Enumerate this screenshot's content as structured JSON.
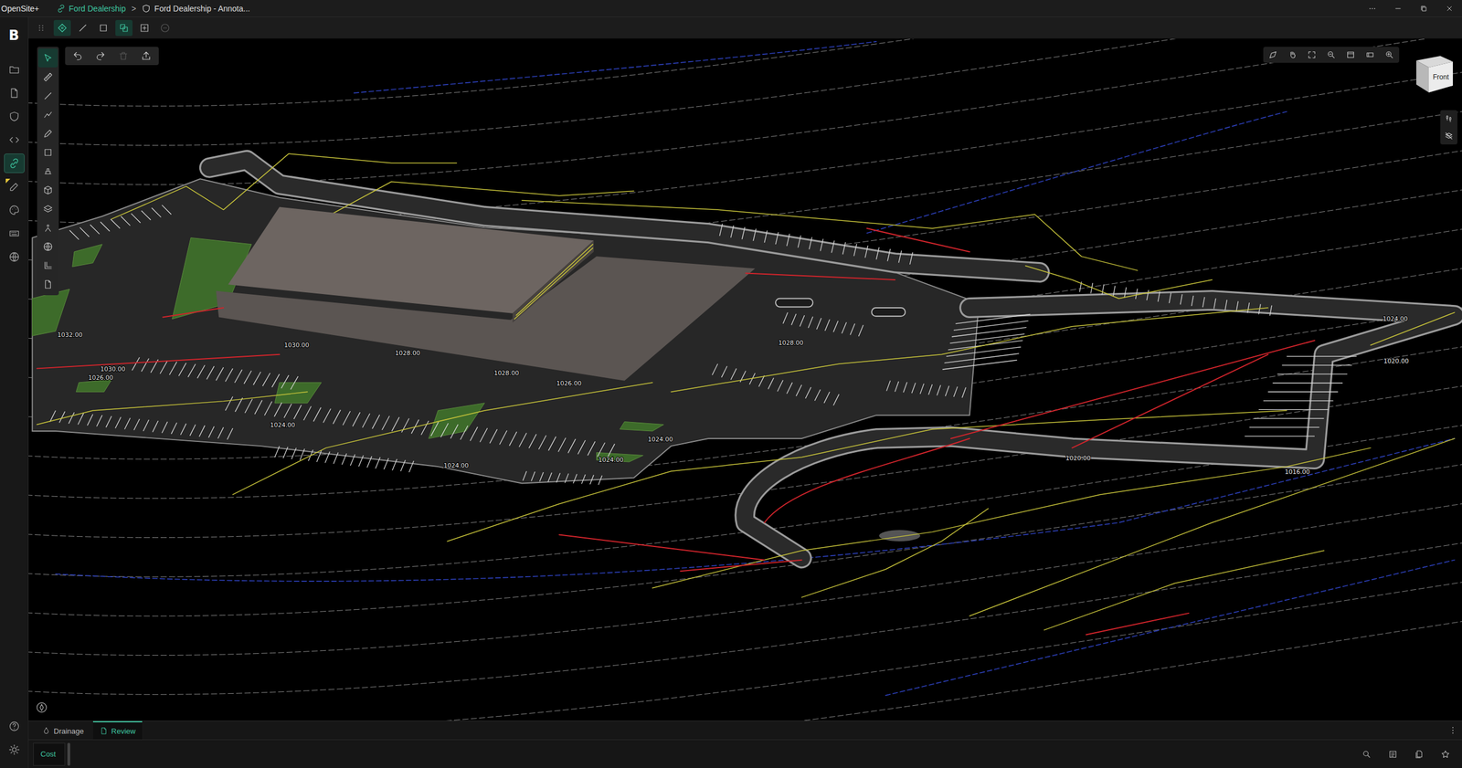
{
  "app": {
    "logo": "B",
    "name": "OpenSite+"
  },
  "breadcrumb": {
    "items": [
      {
        "label": "Ford Dealership",
        "selected": true
      },
      {
        "label": "Ford Dealership - Annota...",
        "selected": false
      }
    ],
    "separator": ">"
  },
  "modeBar": [
    {
      "active": true,
      "disabled": false
    },
    {
      "active": false,
      "disabled": false
    },
    {
      "active": false,
      "disabled": false
    },
    {
      "active": true,
      "disabled": false
    },
    {
      "active": false,
      "disabled": false
    },
    {
      "active": false,
      "disabled": true
    }
  ],
  "rail": [
    {
      "selected": false,
      "marked": false
    },
    {
      "selected": false,
      "marked": false
    },
    {
      "selected": false,
      "marked": false
    },
    {
      "selected": false,
      "marked": false
    },
    {
      "selected": true,
      "marked": false
    },
    {
      "selected": false,
      "marked": true
    },
    {
      "selected": false,
      "marked": false
    },
    {
      "selected": false,
      "marked": false
    },
    {
      "selected": false,
      "marked": false
    }
  ],
  "tools": [
    {
      "selected": true
    },
    {
      "selected": false
    },
    {
      "selected": false
    },
    {
      "selected": false
    },
    {
      "selected": false
    },
    {
      "selected": false
    },
    {
      "selected": false
    },
    {
      "selected": false
    },
    {
      "selected": false
    },
    {
      "selected": false
    },
    {
      "selected": false
    },
    {
      "selected": false
    },
    {
      "selected": false
    }
  ],
  "actions": [
    {
      "disabled": false
    },
    {
      "disabled": false
    },
    {
      "disabled": true
    },
    {
      "disabled": false
    }
  ],
  "viewCube": {
    "face": "Front"
  },
  "contourLabels": [
    "1032.00",
    "1030.00",
    "1028.00",
    "1030.00",
    "1026.00",
    "1028.00",
    "1026.00",
    "1024.00",
    "1024.00",
    "1024.00",
    "1024.00",
    "1028.00",
    "1024.00",
    "1020.00",
    "1020.00",
    "1016.00"
  ],
  "bottomTabs": [
    {
      "label": "Drainage",
      "selected": false
    },
    {
      "label": "Review",
      "selected": true
    }
  ],
  "reviewList": [
    {
      "label": "Cost",
      "selected": true
    }
  ]
}
